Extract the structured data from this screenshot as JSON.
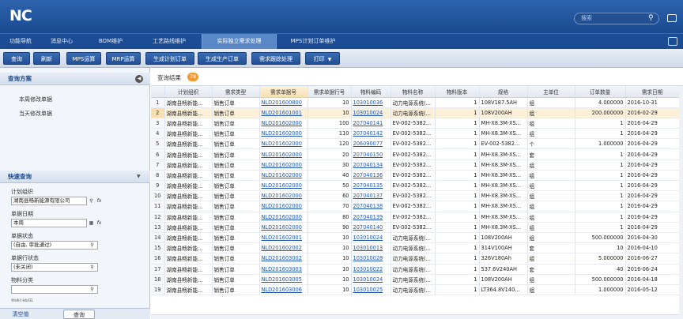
{
  "app": {
    "logo": "NC",
    "search_placeholder": "搜索"
  },
  "nav": {
    "tabs": [
      "功能导航",
      "消息中心",
      "BOM维护",
      "工艺路线维护",
      "实际独立需求处理",
      "MPS计划订单维护"
    ],
    "active": 4
  },
  "toolbar": {
    "buttons": [
      "查询",
      "刷新",
      "MPS运算",
      "MRP运算",
      "生成计划订单",
      "生成生产订单",
      "需求跟踪处理",
      "打印"
    ]
  },
  "left": {
    "scheme_title": "查询方案",
    "schemes": [
      "本周修改单据",
      "当天修改单据"
    ],
    "quick_title": "快速查询",
    "fields": [
      {
        "label": "计划组织",
        "value": "湖南县畅新能源有限公司"
      },
      {
        "label": "单据日期",
        "value": "本周"
      },
      {
        "label": "单据状态",
        "value": "(自由, 审批通过)"
      },
      {
        "label": "单据行状态",
        "value": "(未关闭)"
      },
      {
        "label": "物料分类",
        "value": ""
      }
    ],
    "cut_label": "物料编码",
    "clear_label": "清空值",
    "query_label": "查询"
  },
  "main": {
    "result_title": "查询结果",
    "result_count": "78",
    "columns": [
      "",
      "计划组织",
      "需求类型",
      "需求单据号",
      "需求单据行号",
      "物料编码",
      "物料名称",
      "物料版本",
      "规格",
      "主单位",
      "订单数量",
      "需求日期"
    ],
    "rows": [
      [
        "1",
        "湖南县畅新能...",
        "销售订单",
        "NLD201600800",
        "10",
        "103010036",
        "动力电源系统(...",
        "1",
        "108V187.5AH",
        "组",
        "4.000000",
        "2016-10-31"
      ],
      [
        "2",
        "湖南县畅新能...",
        "销售订单",
        "NLD201601001",
        "10",
        "103010024",
        "动力电源系统(...",
        "1",
        "108V200AH",
        "组",
        "200.000000",
        "2016-02-29"
      ],
      [
        "3",
        "湖南县畅新能...",
        "销售订单",
        "NLD201602000",
        "100",
        "207040141",
        "EV-002-5382...",
        "1",
        "MH-X8.3M-XS...",
        "组",
        "1",
        "2016-04-29"
      ],
      [
        "4",
        "湖南县畅新能...",
        "销售订单",
        "NLD201602000",
        "110",
        "207040142",
        "EV-002-5382...",
        "1",
        "MH-X8.3M-XS...",
        "组",
        "1",
        "2016-04-29"
      ],
      [
        "5",
        "湖南县畅新能...",
        "销售订单",
        "NLD201602000",
        "120",
        "206090077",
        "EV-002-5382...",
        "1",
        "EV-002-5382...",
        "个",
        "1.000000",
        "2016-04-29"
      ],
      [
        "6",
        "湖南县畅新能...",
        "销售订单",
        "NLD201602000",
        "20",
        "207040150",
        "EV-002-5382...",
        "1",
        "MH-X8.3M-XS...",
        "套",
        "1",
        "2016-04-29"
      ],
      [
        "7",
        "湖南县畅新能...",
        "销售订单",
        "NLD201602000",
        "30",
        "207040134",
        "EV-002-5382...",
        "1",
        "MH-X8.3M-XS...",
        "组",
        "1",
        "2016-04-29"
      ],
      [
        "8",
        "湖南县畅新能...",
        "销售订单",
        "NLD201602000",
        "40",
        "207040136",
        "EV-002-5382...",
        "1",
        "MH-X8.3M-XS...",
        "组",
        "1",
        "2016-04-29"
      ],
      [
        "9",
        "湖南县畅新能...",
        "销售订单",
        "NLD201602000",
        "50",
        "207040135",
        "EV-002-5382...",
        "1",
        "MH-X8.3M-XS...",
        "组",
        "1",
        "2016-04-29"
      ],
      [
        "10",
        "湖南县畅新能...",
        "销售订单",
        "NLD201602000",
        "60",
        "207040137",
        "EV-002-5382...",
        "1",
        "MH-X8.3M-XS...",
        "组",
        "1",
        "2016-04-29"
      ],
      [
        "11",
        "湖南县畅新能...",
        "销售订单",
        "NLD201602000",
        "70",
        "207040138",
        "EV-002-5382...",
        "1",
        "MH-X8.3M-XS...",
        "组",
        "1",
        "2016-04-29"
      ],
      [
        "12",
        "湖南县畅新能...",
        "销售订单",
        "NLD201602000",
        "80",
        "207040139",
        "EV-002-5382...",
        "1",
        "MH-X8.3M-XS...",
        "组",
        "1",
        "2016-04-29"
      ],
      [
        "13",
        "湖南县畅新能...",
        "销售订单",
        "NLD201602000",
        "90",
        "207040140",
        "EV-002-5382...",
        "1",
        "MH-X8.3M-XS...",
        "组",
        "1",
        "2016-04-29"
      ],
      [
        "14",
        "湖南县畅新能...",
        "销售订单",
        "NLD201602001",
        "10",
        "103010024",
        "动力电源系统(...",
        "1",
        "108V200AH",
        "组",
        "500.000000",
        "2016-04-30"
      ],
      [
        "15",
        "湖南县畅新能...",
        "销售订单",
        "NLD201602002",
        "10",
        "103010013",
        "动力电源系统(...",
        "1",
        "314V100AH",
        "套",
        "10",
        "2016-04-10"
      ],
      [
        "16",
        "湖南县畅新能...",
        "销售订单",
        "NLD201603002",
        "10",
        "103010028",
        "动力电源系统(...",
        "1",
        "326V180Ah",
        "组",
        "5.000000",
        "2016-06-27"
      ],
      [
        "17",
        "湖南县畅新能...",
        "销售订单",
        "NLD201603003",
        "10",
        "103010022",
        "动力电源系统(...",
        "1",
        "537.6V240AH",
        "套",
        "40",
        "2016-06-24"
      ],
      [
        "18",
        "湖南县畅新能...",
        "销售订单",
        "NLD201603005",
        "10",
        "103010024",
        "动力电源系统(...",
        "1",
        "108V200AH",
        "组",
        "500.000000",
        "2016-04-18"
      ],
      [
        "19",
        "湖南县畅新能...",
        "销售订单",
        "NLD201603006",
        "10",
        "103010025",
        "动力电源系统(...",
        "1",
        "LT364.8V140...",
        "组",
        "1.000000",
        "2016-05-12"
      ]
    ]
  }
}
